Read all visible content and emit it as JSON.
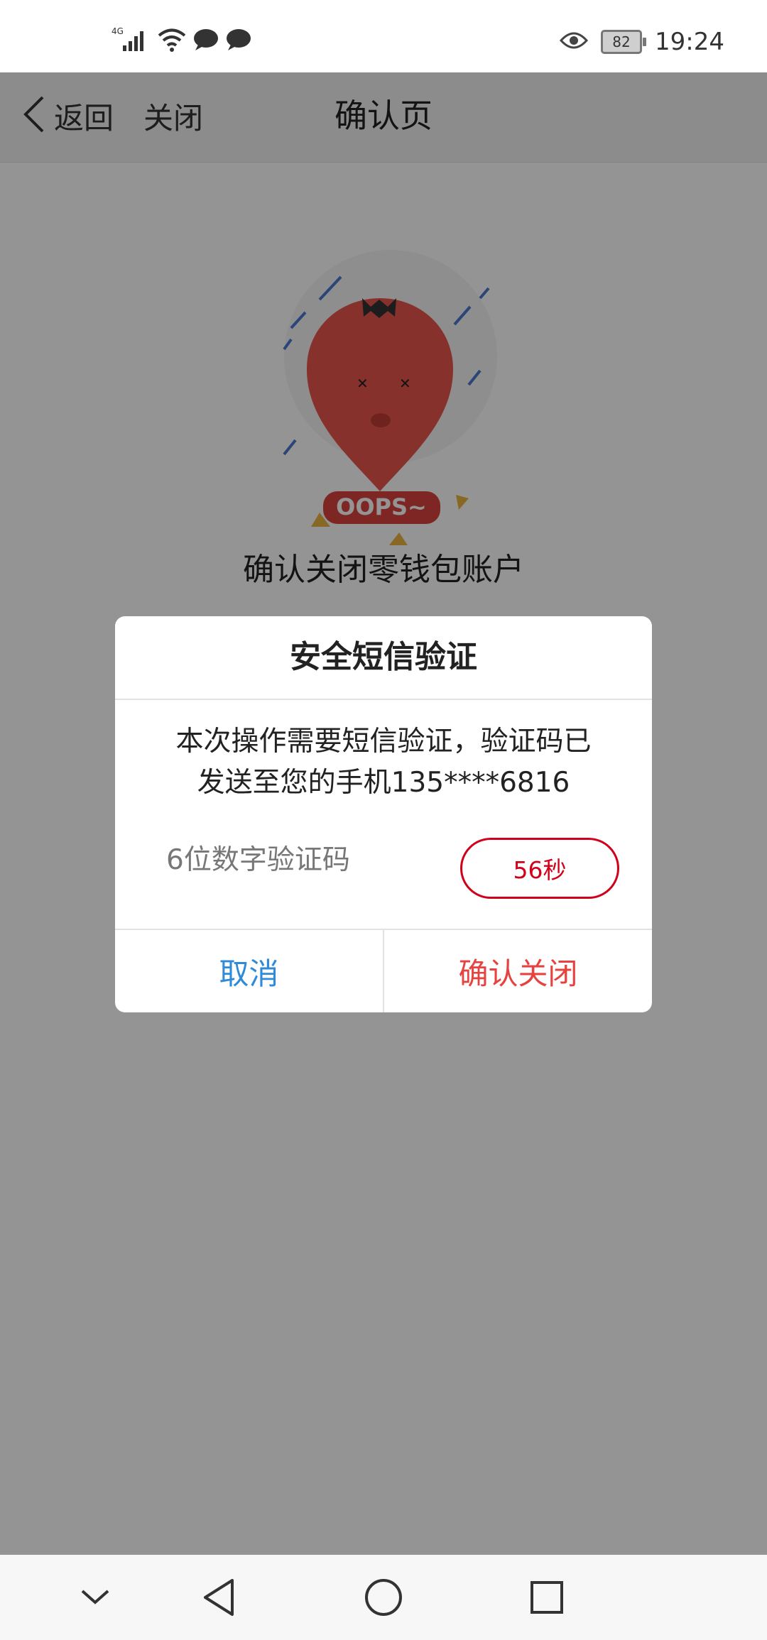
{
  "status_bar": {
    "network_label": "4G",
    "battery_level": "82",
    "time": "19:24",
    "icons": [
      "signal-icon",
      "wifi-icon",
      "message-icon",
      "message-icon",
      "eye-icon",
      "battery-icon"
    ]
  },
  "nav": {
    "back_label": "返回",
    "close_label": "关闭",
    "title": "确认页"
  },
  "page": {
    "illustration_text": "OOPS~",
    "heading": "确认关闭零钱包账户"
  },
  "dialog": {
    "title": "安全短信验证",
    "message_line1": "本次操作需要短信验证，验证码已",
    "message_line2": "发送至您的手机135****6816",
    "code_placeholder": "6位数字验证码",
    "countdown": "56秒",
    "cancel_label": "取消",
    "confirm_label": "确认关闭"
  },
  "colors": {
    "accent_red": "#d0021b",
    "cancel_blue": "#2f8bd8",
    "confirm_red": "#e64340"
  },
  "system_nav": {
    "icons": [
      "collapse-icon",
      "back-triangle-icon",
      "home-circle-icon",
      "recents-square-icon"
    ]
  }
}
